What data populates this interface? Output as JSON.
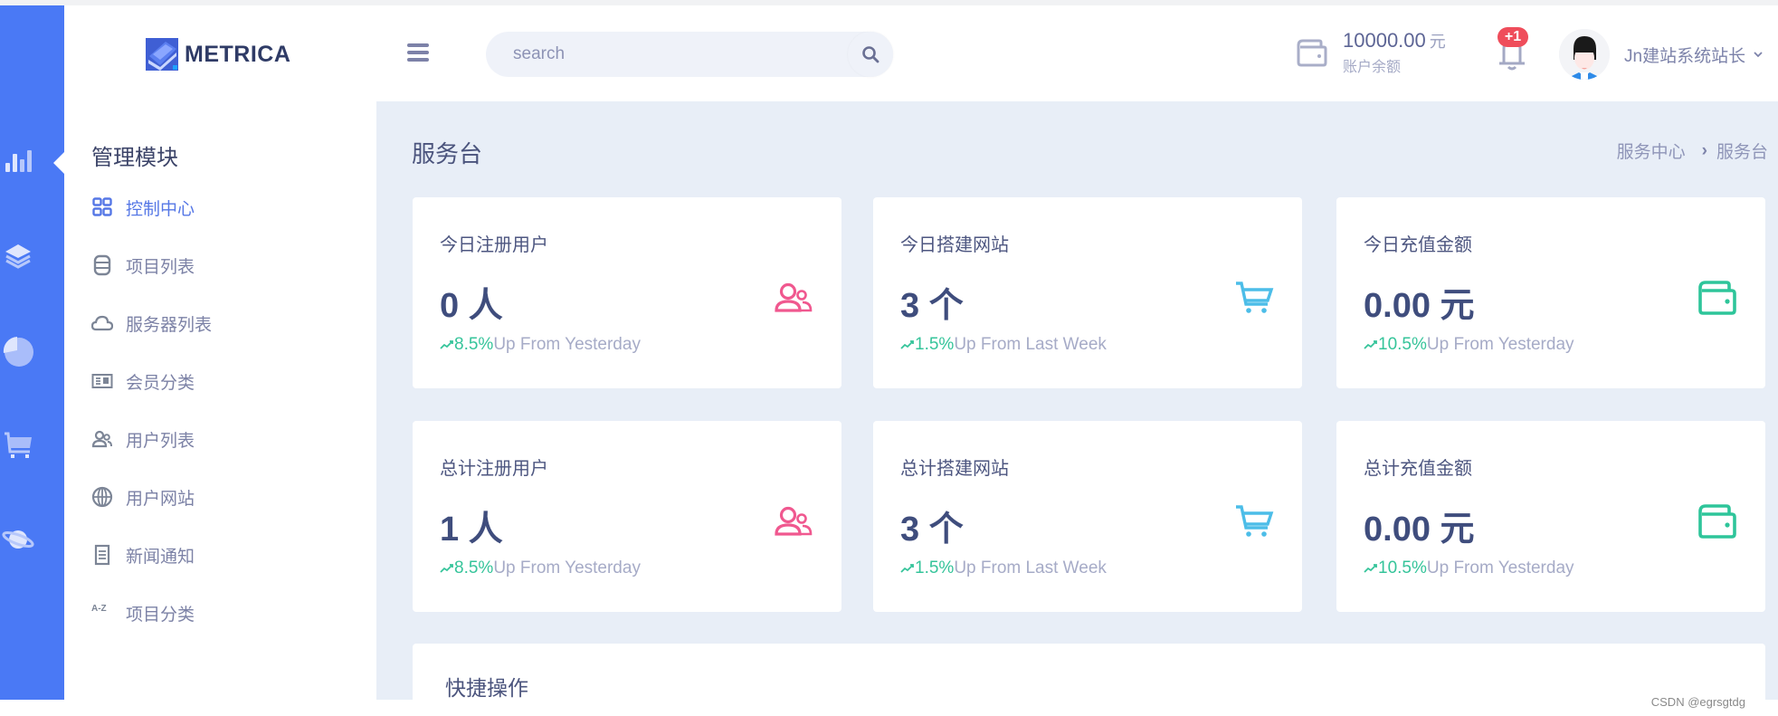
{
  "header": {
    "brand": "METRICA",
    "search_placeholder": "search",
    "search_value": "",
    "balance_amount": "10000.00",
    "balance_unit": "元",
    "balance_label": "账户余额",
    "notification_badge": "+1",
    "username": "Jn建站系统站长"
  },
  "rail": {
    "icons": [
      "bar-chart-icon",
      "layers-icon",
      "pie-chart-icon",
      "cart-icon",
      "planet-icon"
    ],
    "active_index": 0
  },
  "menu": {
    "title": "管理模块",
    "items": [
      {
        "label": "控制中心",
        "icon": "grid-icon",
        "active": true
      },
      {
        "label": "项目列表",
        "icon": "database-icon",
        "active": false
      },
      {
        "label": "服务器列表",
        "icon": "cloud-icon",
        "active": false
      },
      {
        "label": "会员分类",
        "icon": "id-card-icon",
        "active": false
      },
      {
        "label": "用户列表",
        "icon": "users-icon",
        "active": false
      },
      {
        "label": "用户网站",
        "icon": "globe-icon",
        "active": false
      },
      {
        "label": "新闻通知",
        "icon": "document-icon",
        "active": false
      },
      {
        "label": "项目分类",
        "icon": "a-z-sort-icon",
        "active": false
      }
    ]
  },
  "main": {
    "page_title": "服务台",
    "breadcrumb": [
      "服务中心",
      "服务台"
    ],
    "cards": [
      {
        "title": "今日注册用户",
        "value": "0 人",
        "trend_pct": "8.5%",
        "trend_text": "Up From Yesterday",
        "icon": "users-icon",
        "color": "#f0588f"
      },
      {
        "title": "今日搭建网站",
        "value": "3 个",
        "trend_pct": "1.5%",
        "trend_text": " Up From Last Week",
        "icon": "cart-icon",
        "color": "#4cbde8"
      },
      {
        "title": "今日充值金额",
        "value": "0.00 元",
        "trend_pct": "10.5%",
        "trend_text": " Up From Yesterday",
        "icon": "wallet-icon",
        "color": "#2ec59a"
      },
      {
        "title": "总计注册用户",
        "value": "1 人",
        "trend_pct": "8.5%",
        "trend_text": "Up From Yesterday",
        "icon": "users-icon",
        "color": "#f0588f"
      },
      {
        "title": "总计搭建网站",
        "value": "3 个",
        "trend_pct": "1.5%",
        "trend_text": " Up From Last Week",
        "icon": "cart-icon",
        "color": "#4cbde8"
      },
      {
        "title": "总计充值金额",
        "value": "0.00 元",
        "trend_pct": "10.5%",
        "trend_text": " Up From Yesterday",
        "icon": "wallet-icon",
        "color": "#2ec59a"
      }
    ],
    "quick_actions_title": "快捷操作"
  },
  "watermark": "CSDN @egrsgtdg",
  "colors": {
    "rail": "#4a79f5",
    "main_bg": "#e8eef7",
    "active": "#5577e6",
    "trend_up": "#35c49a",
    "badge": "#ef4d5b"
  }
}
